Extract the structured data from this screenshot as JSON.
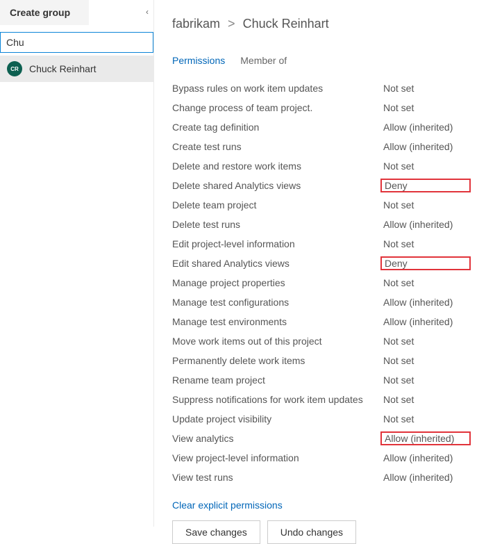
{
  "left": {
    "create_group_label": "Create group",
    "search_value": "Chu",
    "user": {
      "initials": "CR",
      "name": "Chuck Reinhart"
    }
  },
  "breadcrumb": {
    "org": "fabrikam",
    "user": "Chuck Reinhart"
  },
  "tabs": {
    "permissions": "Permissions",
    "member_of": "Member of"
  },
  "permissions": [
    {
      "label": "Bypass rules on work item updates",
      "value": "Not set",
      "highlight": false
    },
    {
      "label": "Change process of team project.",
      "value": "Not set",
      "highlight": false
    },
    {
      "label": "Create tag definition",
      "value": "Allow (inherited)",
      "highlight": false
    },
    {
      "label": "Create test runs",
      "value": "Allow (inherited)",
      "highlight": false
    },
    {
      "label": "Delete and restore work items",
      "value": "Not set",
      "highlight": false
    },
    {
      "label": "Delete shared Analytics views",
      "value": "Deny",
      "highlight": true
    },
    {
      "label": "Delete team project",
      "value": "Not set",
      "highlight": false
    },
    {
      "label": "Delete test runs",
      "value": "Allow (inherited)",
      "highlight": false
    },
    {
      "label": "Edit project-level information",
      "value": "Not set",
      "highlight": false
    },
    {
      "label": "Edit shared Analytics views",
      "value": "Deny",
      "highlight": true
    },
    {
      "label": "Manage project properties",
      "value": "Not set",
      "highlight": false
    },
    {
      "label": "Manage test configurations",
      "value": "Allow (inherited)",
      "highlight": false
    },
    {
      "label": "Manage test environments",
      "value": "Allow (inherited)",
      "highlight": false
    },
    {
      "label": "Move work items out of this project",
      "value": "Not set",
      "highlight": false
    },
    {
      "label": "Permanently delete work items",
      "value": "Not set",
      "highlight": false
    },
    {
      "label": "Rename team project",
      "value": "Not set",
      "highlight": false
    },
    {
      "label": "Suppress notifications for work item updates",
      "value": "Not set",
      "highlight": false
    },
    {
      "label": "Update project visibility",
      "value": "Not set",
      "highlight": false
    },
    {
      "label": "View analytics",
      "value": "Allow (inherited)",
      "highlight": true
    },
    {
      "label": "View project-level information",
      "value": "Allow (inherited)",
      "highlight": false
    },
    {
      "label": "View test runs",
      "value": "Allow (inherited)",
      "highlight": false
    }
  ],
  "actions": {
    "clear": "Clear explicit permissions",
    "save": "Save changes",
    "undo": "Undo changes"
  }
}
